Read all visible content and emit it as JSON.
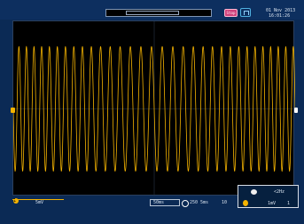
{
  "header": {
    "date": "01 Nov 2013",
    "time": "16:01:26",
    "run_state": "Stop"
  },
  "footer": {
    "channel": "1",
    "channel_vdiv": "5mV",
    "timebase": "50ms",
    "sample_rate": "250 5ms",
    "trigger_level": "10",
    "frequency_label": "<2Hz",
    "measure_value": "<2Hz",
    "measure_unit": "1mV"
  },
  "signal": {
    "color": "#f4b300",
    "cycles": 32
  }
}
